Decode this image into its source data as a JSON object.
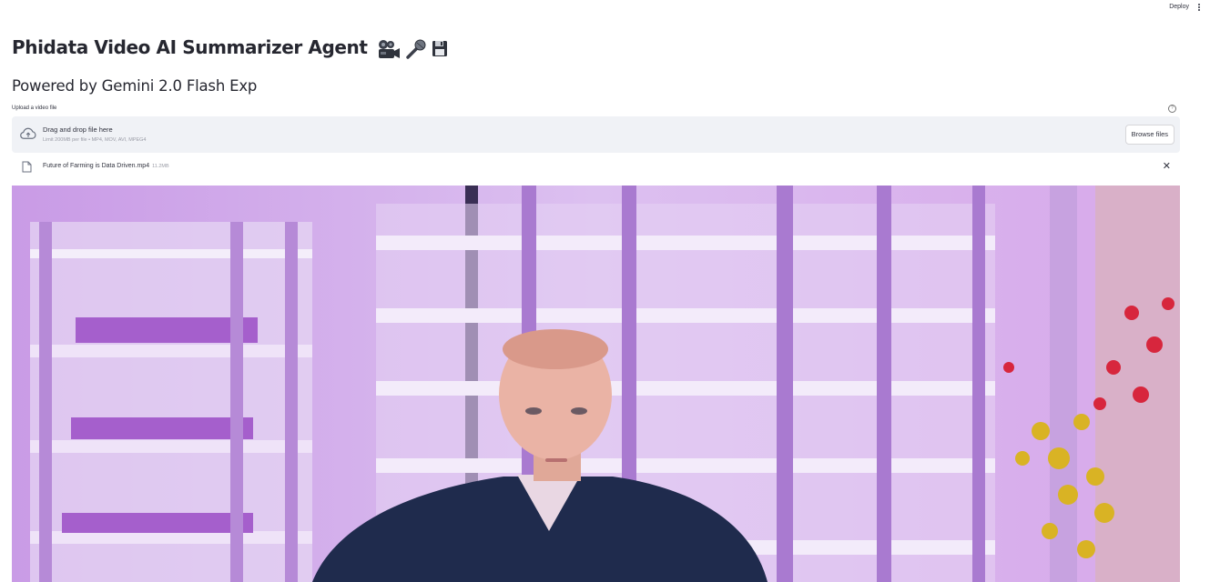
{
  "header": {
    "deploy_label": "Deploy",
    "menu_icon": "kebab-menu-icon"
  },
  "page": {
    "title": "Phidata Video AI Summarizer Agent",
    "title_emojis": [
      "movie-camera-icon",
      "microphone-icon",
      "floppy-disk-icon"
    ],
    "subtitle": "Powered by Gemini 2.0 Flash Exp"
  },
  "uploader": {
    "label": "Upload a video file",
    "help_icon": "help-circle-icon",
    "drop_title": "Drag and drop file here",
    "limit_text": "Limit 200MB per file • MP4, MOV, AVI, MPEG4",
    "browse_label": "Browse files",
    "upload_icon": "cloud-upload-icon"
  },
  "uploaded_file": {
    "name": "Future of Farming is Data Driven.mp4",
    "size": "11.2MB",
    "icon": "file-icon",
    "remove_icon": "close-icon"
  },
  "colors": {
    "dropzone_bg": "#f0f2f6",
    "text": "#31333f",
    "video_tint": "#cfa6e4"
  }
}
